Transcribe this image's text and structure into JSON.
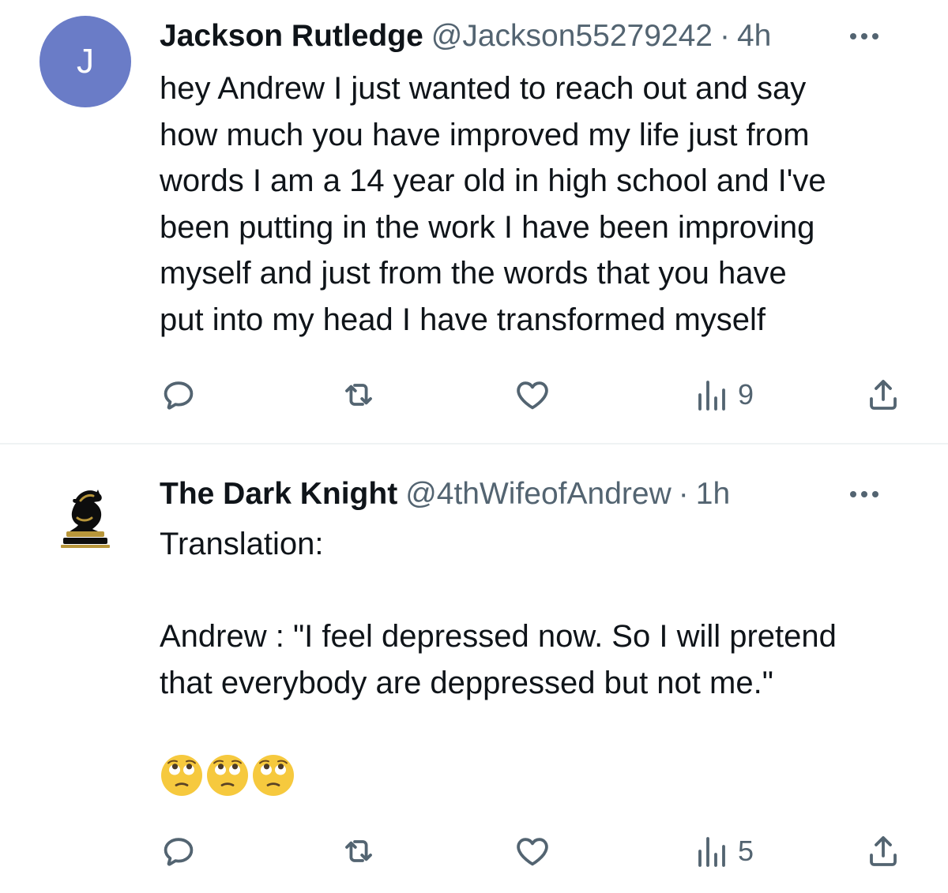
{
  "tweets": [
    {
      "avatar_letter": "J",
      "avatar_color": "#6a7cc7",
      "display_name": "Jackson Rutledge",
      "handle": "@Jackson55279242",
      "separator": "·",
      "time": "4h",
      "text": "hey Andrew I just wanted to reach out and say\nhow much you have improved my life just from\nwords I am a 14 year old in high school and I've\nbeen putting in the work I have been improving\nmyself and just from the words that you have\nput into my head I have transformed myself",
      "views": "9",
      "icons": [
        "reply-icon",
        "retweet-icon",
        "like-icon",
        "views-icon",
        "share-icon",
        "more-icon"
      ]
    },
    {
      "avatar_icon": "knight-chess-piece",
      "display_name": "The Dark Knight",
      "handle": "@4thWifeofAndrew",
      "separator": "·",
      "time": "1h",
      "text": "Translation:\n\nAndrew : \"I feel depressed now. So I will pretend\nthat everybody are deppressed but not me.\"",
      "emojis": [
        "face-with-rolling-eyes",
        "face-with-rolling-eyes",
        "face-with-rolling-eyes"
      ],
      "views": "5",
      "icons": [
        "reply-icon",
        "retweet-icon",
        "like-icon",
        "views-icon",
        "share-icon",
        "more-icon"
      ]
    }
  ],
  "colors": {
    "text_primary": "#0f1419",
    "text_secondary": "#536471",
    "divider": "#eff3f4"
  }
}
